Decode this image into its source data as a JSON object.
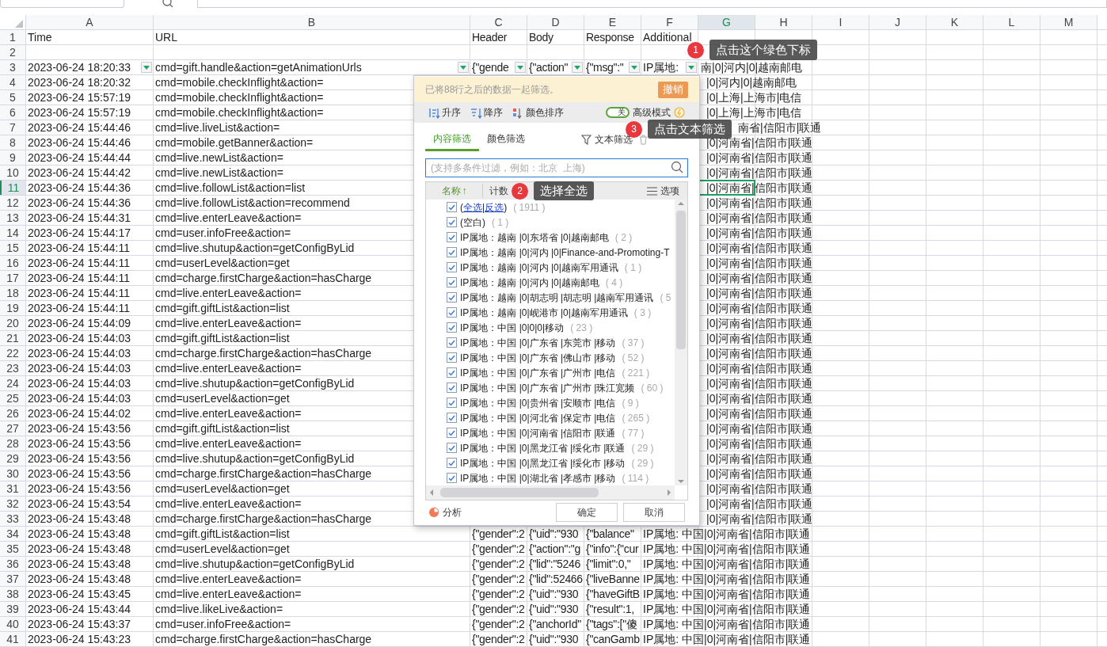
{
  "columns": [
    {
      "letter": "A",
      "selected": false
    },
    {
      "letter": "B",
      "selected": false
    },
    {
      "letter": "C",
      "selected": false
    },
    {
      "letter": "D",
      "selected": false
    },
    {
      "letter": "E",
      "selected": false
    },
    {
      "letter": "F",
      "selected": false
    },
    {
      "letter": "G",
      "selected": true
    },
    {
      "letter": "H",
      "selected": false
    },
    {
      "letter": "I",
      "selected": false
    },
    {
      "letter": "J",
      "selected": false
    },
    {
      "letter": "K",
      "selected": false
    },
    {
      "letter": "L",
      "selected": false
    },
    {
      "letter": "M",
      "selected": false
    }
  ],
  "rows": [
    {
      "number": "1",
      "kind": "header",
      "selected": false,
      "cells": [
        "Time",
        "URL",
        "Header",
        "Body",
        "Response",
        "Additional"
      ]
    },
    {
      "number": "2",
      "kind": "empty",
      "selected": false
    },
    {
      "number": "3",
      "kind": "filter",
      "selected": false,
      "cells": [
        "2023-06-24 18:20:33",
        "cmd=gift.handle&action=getAnimationUrls",
        "{\"gende",
        "{\"action\"",
        "{\"msg\":\"",
        "IP属地:"
      ],
      "tail": "南|0|河内|0|越南邮电"
    },
    {
      "number": "4",
      "kind": "tail",
      "selected": false,
      "cells": [
        "2023-06-24 18:20:32",
        "cmd=mobile.checkInflight&action="
      ],
      "tail": "|0|河内|0|越南邮电"
    },
    {
      "number": "5",
      "kind": "tail",
      "selected": false,
      "cells": [
        "2023-06-24 15:57:19",
        "cmd=mobile.checkInflight&action="
      ],
      "tail": "|0|上海|上海市|电信"
    },
    {
      "number": "6",
      "kind": "tail",
      "selected": false,
      "cells": [
        "2023-06-24 15:57:19",
        "cmd=mobile.checkInflight&action="
      ],
      "tail": "|0|上海|上海市|电信"
    },
    {
      "number": "7",
      "kind": "tail-late",
      "selected": false,
      "cells": [
        "2023-06-24 15:44:46",
        "cmd=live.liveList&action="
      ],
      "tail": "南省|信阳市|联通"
    },
    {
      "number": "8",
      "kind": "tail",
      "selected": false,
      "cells": [
        "2023-06-24 15:44:46",
        "cmd=mobile.getBanner&action="
      ],
      "tail": "|0|河南省|信阳市|联通"
    },
    {
      "number": "9",
      "kind": "tail",
      "selected": false,
      "cells": [
        "2023-06-24 15:44:44",
        "cmd=live.newList&action="
      ],
      "tail": "|0|河南省|信阳市|联通"
    },
    {
      "number": "10",
      "kind": "tail",
      "selected": false,
      "cells": [
        "2023-06-24 15:44:42",
        "cmd=live.newList&action="
      ],
      "tail": "|0|河南省|信阳市|联通"
    },
    {
      "number": "11",
      "kind": "tail",
      "selected": true,
      "cells": [
        "2023-06-24 15:44:36",
        "cmd=live.followList&action=list"
      ],
      "tail": "|0|河南省|信阳市|联通"
    },
    {
      "number": "12",
      "kind": "tail",
      "selected": false,
      "cells": [
        "2023-06-24 15:44:36",
        "cmd=live.followList&action=recommend"
      ],
      "tail": "|0|河南省|信阳市|联通"
    },
    {
      "number": "13",
      "kind": "tail",
      "selected": false,
      "cells": [
        "2023-06-24 15:44:31",
        "cmd=live.enterLeave&action="
      ],
      "tail": "|0|河南省|信阳市|联通"
    },
    {
      "number": "14",
      "kind": "tail",
      "selected": false,
      "cells": [
        "2023-06-24 15:44:17",
        "cmd=user.infoFree&action="
      ],
      "tail": "|0|河南省|信阳市|联通"
    },
    {
      "number": "15",
      "kind": "tail",
      "selected": false,
      "cells": [
        "2023-06-24 15:44:11",
        "cmd=live.shutup&action=getConfigByLid"
      ],
      "tail": "|0|河南省|信阳市|联通"
    },
    {
      "number": "16",
      "kind": "tail",
      "selected": false,
      "cells": [
        "2023-06-24 15:44:11",
        "cmd=userLevel&action=get"
      ],
      "tail": "|0|河南省|信阳市|联通"
    },
    {
      "number": "17",
      "kind": "tail",
      "selected": false,
      "cells": [
        "2023-06-24 15:44:11",
        "cmd=charge.firstCharge&action=hasCharge"
      ],
      "tail": "|0|河南省|信阳市|联通"
    },
    {
      "number": "18",
      "kind": "tail",
      "selected": false,
      "cells": [
        "2023-06-24 15:44:11",
        "cmd=live.enterLeave&action="
      ],
      "tail": "|0|河南省|信阳市|联通"
    },
    {
      "number": "19",
      "kind": "tail",
      "selected": false,
      "cells": [
        "2023-06-24 15:44:11",
        "cmd=gift.giftList&action=list"
      ],
      "tail": "|0|河南省|信阳市|联通"
    },
    {
      "number": "20",
      "kind": "tail",
      "selected": false,
      "cells": [
        "2023-06-24 15:44:09",
        "cmd=live.enterLeave&action="
      ],
      "tail": "|0|河南省|信阳市|联通"
    },
    {
      "number": "21",
      "kind": "tail",
      "selected": false,
      "cells": [
        "2023-06-24 15:44:03",
        "cmd=gift.giftList&action=list"
      ],
      "tail": "|0|河南省|信阳市|联通"
    },
    {
      "number": "22",
      "kind": "tail",
      "selected": false,
      "cells": [
        "2023-06-24 15:44:03",
        "cmd=charge.firstCharge&action=hasCharge"
      ],
      "tail": "|0|河南省|信阳市|联通"
    },
    {
      "number": "23",
      "kind": "tail",
      "selected": false,
      "cells": [
        "2023-06-24 15:44:03",
        "cmd=live.enterLeave&action="
      ],
      "tail": "|0|河南省|信阳市|联通"
    },
    {
      "number": "24",
      "kind": "tail",
      "selected": false,
      "cells": [
        "2023-06-24 15:44:03",
        "cmd=live.shutup&action=getConfigByLid"
      ],
      "tail": "|0|河南省|信阳市|联通"
    },
    {
      "number": "25",
      "kind": "tail",
      "selected": false,
      "cells": [
        "2023-06-24 15:44:03",
        "cmd=userLevel&action=get"
      ],
      "tail": "|0|河南省|信阳市|联通"
    },
    {
      "number": "26",
      "kind": "tail",
      "selected": false,
      "cells": [
        "2023-06-24 15:44:02",
        "cmd=live.enterLeave&action="
      ],
      "tail": "|0|河南省|信阳市|联通"
    },
    {
      "number": "27",
      "kind": "tail",
      "selected": false,
      "cells": [
        "2023-06-24 15:43:56",
        "cmd=gift.giftList&action=list"
      ],
      "tail": "|0|河南省|信阳市|联通"
    },
    {
      "number": "28",
      "kind": "tail",
      "selected": false,
      "cells": [
        "2023-06-24 15:43:56",
        "cmd=live.enterLeave&action="
      ],
      "tail": "|0|河南省|信阳市|联通"
    },
    {
      "number": "29",
      "kind": "tail",
      "selected": false,
      "cells": [
        "2023-06-24 15:43:56",
        "cmd=live.shutup&action=getConfigByLid"
      ],
      "tail": "|0|河南省|信阳市|联通"
    },
    {
      "number": "30",
      "kind": "tail",
      "selected": false,
      "cells": [
        "2023-06-24 15:43:56",
        "cmd=charge.firstCharge&action=hasCharge"
      ],
      "tail": "|0|河南省|信阳市|联通"
    },
    {
      "number": "31",
      "kind": "tail",
      "selected": false,
      "cells": [
        "2023-06-24 15:43:56",
        "cmd=userLevel&action=get"
      ],
      "tail": "|0|河南省|信阳市|联通"
    },
    {
      "number": "32",
      "kind": "tail",
      "selected": false,
      "cells": [
        "2023-06-24 15:43:54",
        "cmd=live.enterLeave&action="
      ],
      "tail": "|0|河南省|信阳市|联通"
    },
    {
      "number": "33",
      "kind": "tail",
      "selected": false,
      "cells": [
        "2023-06-24 15:43:48",
        "cmd=charge.firstCharge&action=hasCharge"
      ],
      "tail": "|0|河南省|信阳市|联通"
    },
    {
      "number": "34",
      "kind": "full",
      "selected": false,
      "cells": [
        "2023-06-24 15:43:48",
        "cmd=gift.giftList&action=list",
        "{\"gender\":2",
        "{\"uid\":\"930",
        "{\"balance\"",
        "IP属地: 中国|0|河南省|信阳市|联通"
      ]
    },
    {
      "number": "35",
      "kind": "full",
      "selected": false,
      "cells": [
        "2023-06-24 15:43:48",
        "cmd=userLevel&action=get",
        "{\"gender\":2",
        "{\"action\":\"g",
        "{\"info\":{\"cur",
        "IP属地: 中国|0|河南省|信阳市|联通"
      ]
    },
    {
      "number": "36",
      "kind": "full",
      "selected": false,
      "cells": [
        "2023-06-24 15:43:48",
        "cmd=live.shutup&action=getConfigByLid",
        "{\"gender\":2",
        "{\"lid\":\"5246",
        "{\"limit\":0,\"",
        "IP属地: 中国|0|河南省|信阳市|联通"
      ]
    },
    {
      "number": "37",
      "kind": "full",
      "selected": false,
      "cells": [
        "2023-06-24 15:43:48",
        "cmd=live.enterLeave&action=",
        "{\"gender\":2",
        "{\"lid\":52466",
        "{\"liveBanne",
        "IP属地: 中国|0|河南省|信阳市|联通"
      ]
    },
    {
      "number": "38",
      "kind": "full",
      "selected": false,
      "cells": [
        "2023-06-24 15:43:45",
        "cmd=live.enterLeave&action=",
        "{\"gender\":2",
        "{\"uid\":\"930",
        "{\"haveGiftB",
        "IP属地: 中国|0|河南省|信阳市|联通"
      ]
    },
    {
      "number": "39",
      "kind": "full",
      "selected": false,
      "cells": [
        "2023-06-24 15:43:44",
        "cmd=live.likeLive&action=",
        "{\"gender\":2",
        "{\"uid\":\"930",
        "{\"result\":1,",
        "IP属地: 中国|0|河南省|信阳市|联通"
      ]
    },
    {
      "number": "40",
      "kind": "full",
      "selected": false,
      "cells": [
        "2023-06-24 15:43:37",
        "cmd=user.infoFree&action=",
        "{\"gender\":2",
        "{\"anchorId\"",
        "{\"tags\":[\"傻",
        "IP属地: 中国|0|河南省|信阳市|联通"
      ]
    },
    {
      "number": "41",
      "kind": "full",
      "selected": false,
      "cells": [
        "2023-06-24 15:43:23",
        "cmd=charge.firstCharge&action=hasCharge",
        "{\"gender\":2",
        "{\"uid\":\"930",
        "{\"canGamb",
        "IP属地: 中国|0|河南省|信阳市|联通"
      ]
    }
  ],
  "filter_popup": {
    "notice": "已将88行之后的数据一起筛选。",
    "undo_button": "撤销",
    "sort_buttons": [
      {
        "kind": "ascending",
        "label": "升序"
      },
      {
        "kind": "descending",
        "label": "降序"
      },
      {
        "kind": "color",
        "label": "颜色排序"
      }
    ],
    "advanced_mode": {
      "toggle_text": "关",
      "on": false,
      "label": "高级模式"
    },
    "tabs": [
      {
        "label": "内容筛选",
        "selected": true
      },
      {
        "label": "颜色筛选",
        "selected": false
      }
    ],
    "text_filter": "文本筛选",
    "search": {
      "placeholder": "(支持多条件过滤，例如：北京  上海)"
    },
    "list_header": {
      "name": "名称",
      "name_arrow": "↑",
      "count": "计数",
      "options": "选项"
    },
    "items": [
      {
        "kind": "select-all",
        "checked": true,
        "prefix": "(",
        "select_all": "全选",
        "separator": "|",
        "invert": "反选",
        "suffix": ")",
        "count": "( 1911 )"
      },
      {
        "kind": "plain",
        "checked": true,
        "label": "(空白)",
        "count": "( 1 )"
      },
      {
        "kind": "plain",
        "checked": true,
        "label": "IP属地：越南 |0|东塔省 |0|越南邮电",
        "count": "( 2 )"
      },
      {
        "kind": "plain",
        "checked": true,
        "label": "IP属地：越南 |0|河内 |0|Finance-and-Promoting-T"
      },
      {
        "kind": "plain",
        "checked": true,
        "label": "IP属地：越南 |0|河内 |0|越南军用通讯",
        "count": "( 1 )"
      },
      {
        "kind": "plain",
        "checked": true,
        "label": "IP属地：越南 |0|河内 |0|越南邮电",
        "count": "( 4 )"
      },
      {
        "kind": "plain",
        "checked": true,
        "label": "IP属地：越南 |0|胡志明 |胡志明 |越南军用通讯",
        "count": "( 5"
      },
      {
        "kind": "plain",
        "checked": true,
        "label": "IP属地：越南 |0|岘港市 |0|越南军用通讯",
        "count": "( 3 )"
      },
      {
        "kind": "plain",
        "checked": true,
        "label": "IP属地：中国 |0|0|0|移动",
        "count": "( 23 )"
      },
      {
        "kind": "plain",
        "checked": true,
        "label": "IP属地：中国 |0|广东省 |东莞市 |移动",
        "count": "( 37 )"
      },
      {
        "kind": "plain",
        "checked": true,
        "label": "IP属地：中国 |0|广东省 |佛山市 |移动",
        "count": "( 52 )"
      },
      {
        "kind": "plain",
        "checked": true,
        "label": "IP属地：中国 |0|广东省 |广州市 |电信",
        "count": "( 221 )"
      },
      {
        "kind": "plain",
        "checked": true,
        "label": "IP属地：中国 |0|广东省 |广州市 |珠江宽频",
        "count": "( 60 )"
      },
      {
        "kind": "plain",
        "checked": true,
        "label": "IP属地：中国 |0|贵州省 |安顺市 |电信",
        "count": "( 9 )"
      },
      {
        "kind": "plain",
        "checked": true,
        "label": "IP属地：中国 |0|河北省 |保定市 |电信",
        "count": "( 265 )"
      },
      {
        "kind": "plain",
        "checked": true,
        "label": "IP属地：中国 |0|河南省 |信阳市 |联通",
        "count": "( 77 )"
      },
      {
        "kind": "plain",
        "checked": true,
        "label": "IP属地：中国 |0|黑龙江省 |绥化市 |联通",
        "count": "( 29 )"
      },
      {
        "kind": "plain",
        "checked": true,
        "label": "IP属地：中国 |0|黑龙江省 |绥化市 |移动",
        "count": "( 29 )"
      },
      {
        "kind": "plain",
        "checked": true,
        "label": "IP属地：中国 |0|湖北省 |孝感市 |移动",
        "count": "( 114 )"
      }
    ],
    "analysis": "分析",
    "ok_button": "确定",
    "cancel_button": "取消"
  },
  "tips": [
    {
      "number": "1",
      "text": "点击这个绿色下标"
    },
    {
      "number": "2",
      "text": "选择全选"
    },
    {
      "number": "3",
      "text": "点击文本筛选"
    }
  ]
}
